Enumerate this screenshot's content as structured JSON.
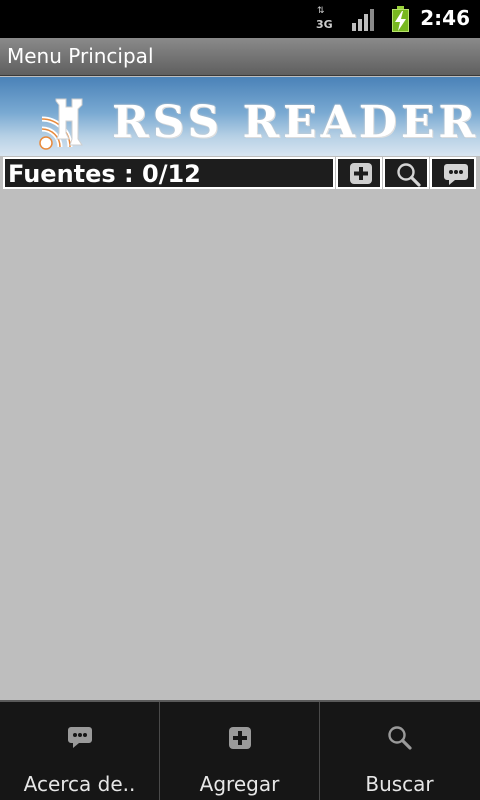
{
  "status_bar": {
    "network_label": "3G",
    "network_arrows": "⇅",
    "time": "2:46",
    "icons": [
      "data-arrows-icon",
      "signal-icon",
      "battery-charging-icon"
    ]
  },
  "title_bar": {
    "title": "Menu Principal"
  },
  "banner": {
    "title": "RSS READER",
    "logo_icon": "rss-logo-icon"
  },
  "toolbar": {
    "sources_label": "Fuentes : 0/12",
    "buttons": [
      {
        "icon": "plus-icon"
      },
      {
        "icon": "search-icon"
      },
      {
        "icon": "chat-bubble-icon"
      }
    ]
  },
  "bottom_menu": {
    "items": [
      {
        "label": "Acerca de..",
        "icon": "chat-bubble-icon"
      },
      {
        "label": "Agregar",
        "icon": "plus-icon"
      },
      {
        "label": "Buscar",
        "icon": "search-icon"
      }
    ]
  },
  "colors": {
    "status_bar_bg": "#000000",
    "title_bar_bg": "#6f6f6f",
    "banner_top": "#4a82b8",
    "content_bg": "#bebebe",
    "toolbar_bg": "#1d1d1d",
    "menu_bg": "#161616",
    "battery": "#78b820"
  }
}
